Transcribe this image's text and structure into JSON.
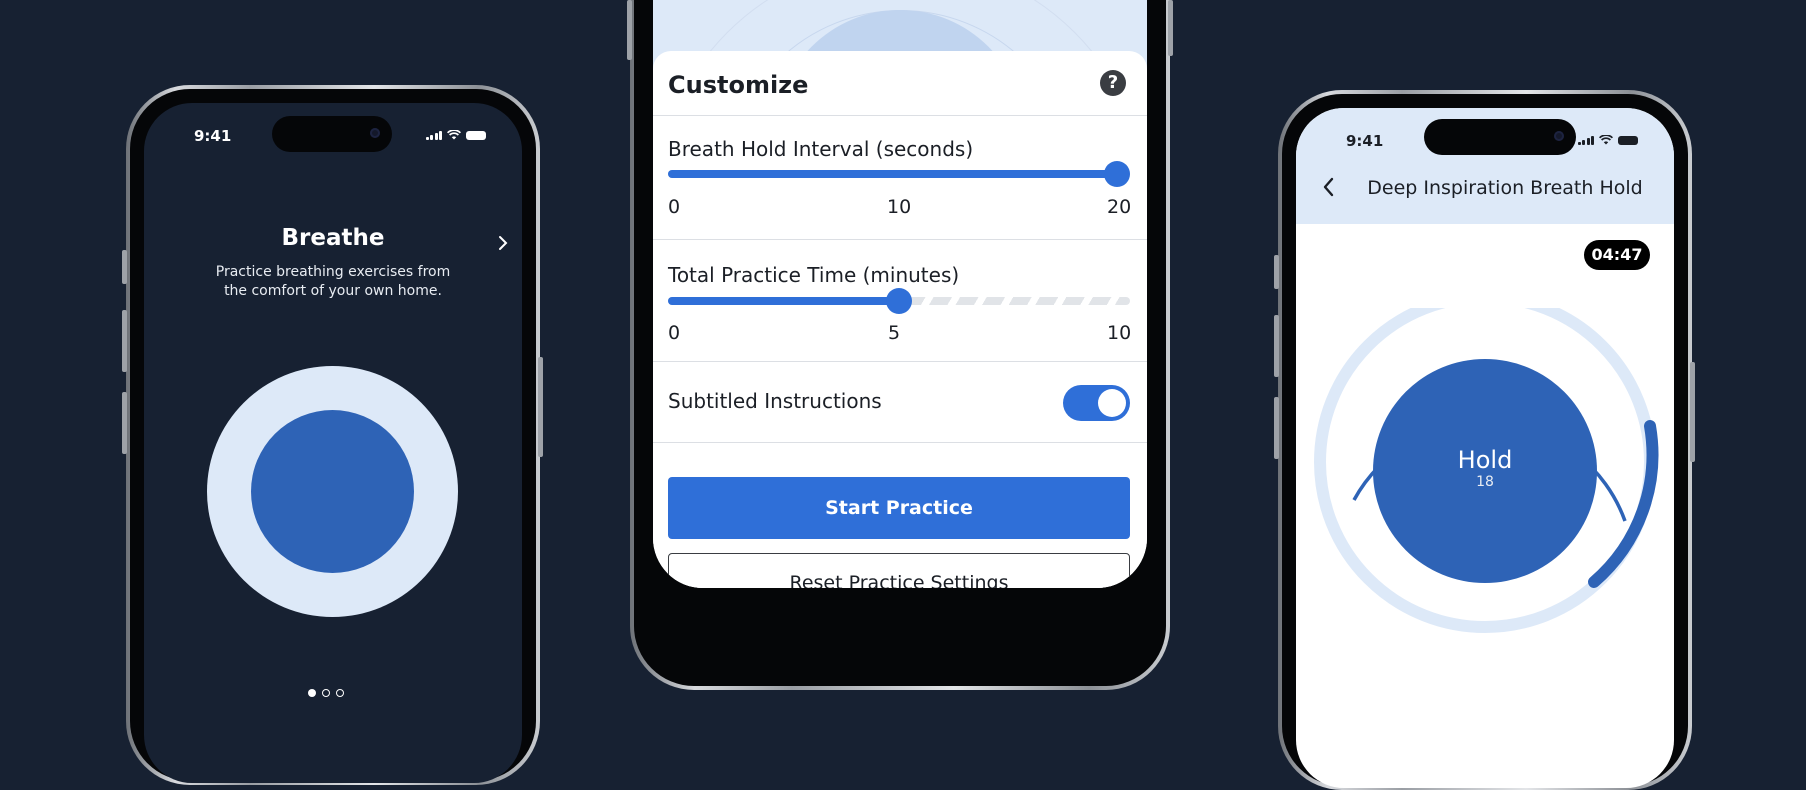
{
  "colors": {
    "background": "#172132",
    "accent": "#2f6fd8",
    "circle_dark": "#2e63b6",
    "circle_light": "#dde9f8"
  },
  "phone_left": {
    "status_time": "9:41",
    "title": "Breathe",
    "next_icon": "chevron-right-icon",
    "description_line1": "Practice breathing exercises from",
    "description_line2": "the comfort of your own home.",
    "page_dots": {
      "count": 3,
      "active_index": 0
    }
  },
  "phone_center": {
    "title": "Customize",
    "help_icon": "?",
    "breath_hold": {
      "label": "Breath Hold Interval (seconds)",
      "tick_min": "0",
      "tick_mid": "10",
      "tick_max": "20",
      "value": 20,
      "max": 20
    },
    "practice_time": {
      "label": "Total Practice Time (minutes)",
      "tick_min": "0",
      "tick_mid": "5",
      "tick_max": "10",
      "value": 5,
      "max": 10
    },
    "subtitles": {
      "label": "Subtitled Instructions",
      "enabled": true
    },
    "start_button": "Start Practice",
    "reset_button": "Reset Practice Settings"
  },
  "phone_right": {
    "status_time": "9:41",
    "back_icon": "chevron-left-icon",
    "title": "Deep Inspiration Breath Hold",
    "timer": "04:47",
    "circle_label": "Hold",
    "circle_count": "18"
  }
}
